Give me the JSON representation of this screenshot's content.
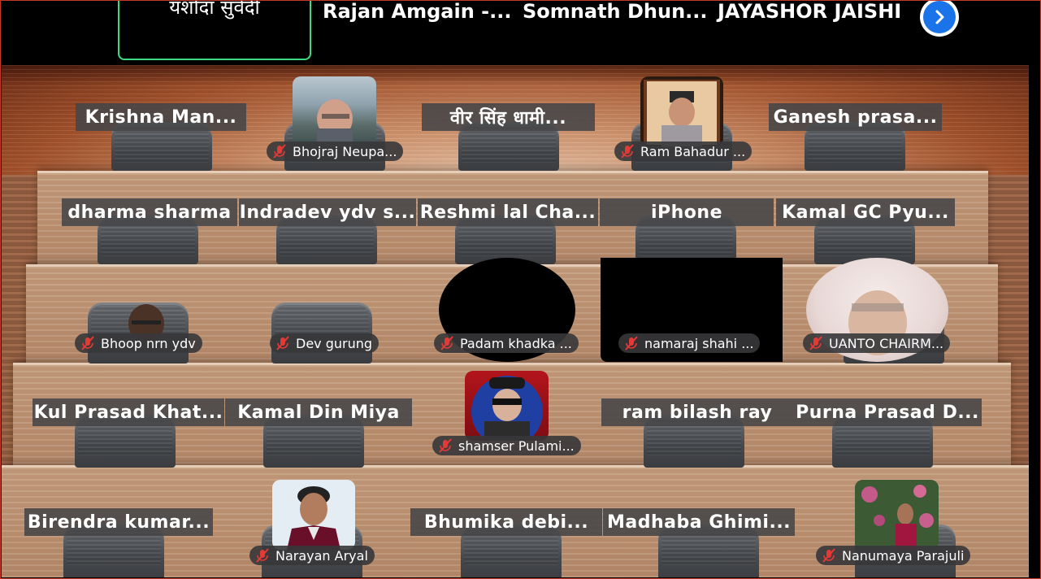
{
  "top_strip": {
    "tiles": [
      "यशोदा सुवेदी",
      "Rajan Amgain -...",
      "Somnath Dhun...",
      "JAYASHOR JAISHI"
    ],
    "next_button_icon": "chevron-right-icon"
  },
  "rows": {
    "row1": {
      "names": [
        "Krishna Man...",
        "वीर सिंह धामी...",
        "Ganesh prasa..."
      ],
      "videos": [
        "Bhojraj Neupa...",
        "Ram Bahadur ..."
      ]
    },
    "row2": {
      "names": [
        "dharma sharma",
        "Indradev ydv s...",
        "Reshmi lal Cha...",
        "iPhone",
        "Kamal GC Pyu..."
      ]
    },
    "row3": {
      "videos": [
        "Bhoop nrn ydv",
        "Dev gurung",
        "Padam khadka ...",
        "namaraj shahi ...",
        "UANTO CHAIRM..."
      ]
    },
    "row4": {
      "names": [
        "Kul Prasad Khat...",
        "Kamal Din Miya",
        "ram bilash ray",
        "Purna Prasad D..."
      ],
      "videos": [
        "shamser Pulami..."
      ]
    },
    "row5": {
      "names": [
        "Birendra kumar...",
        "Bhumika debi...",
        "Madhaba Ghimi..."
      ],
      "videos": [
        "Narayan Aryal",
        "Nanumaya Parajuli"
      ]
    }
  },
  "colors": {
    "active_speaker_border": "#3ddc84",
    "next_button": "#1a73e8",
    "mute_icon": "#e53935"
  }
}
